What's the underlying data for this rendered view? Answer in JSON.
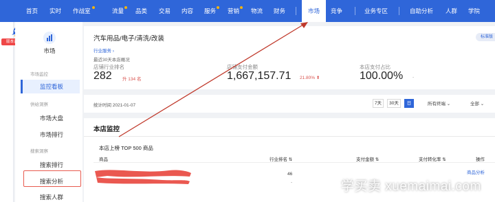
{
  "nav": {
    "items": [
      "首页",
      "实时",
      "作战室",
      "流量",
      "品类",
      "交易",
      "内容",
      "服务",
      "营销",
      "物流",
      "财务",
      "市场",
      "竞争",
      "业务专区",
      "自助分析",
      "人群",
      "学院"
    ],
    "active": "市场"
  },
  "rail": {
    "version_label": "版本说明"
  },
  "sidebar": {
    "module_label": "市场",
    "groups": [
      "市场监控",
      "供给洞察",
      "搜索洞察"
    ],
    "items": [
      "监控看板",
      "市场大盘",
      "市场排行",
      "搜索排行",
      "搜索分析",
      "搜索人群"
    ],
    "active_item": "监控看板",
    "highlighted_item": "搜索分析"
  },
  "overview": {
    "breadcrumb": "汽车用品/电子/清洗/改装",
    "industry_link": "行业服务 ›",
    "standard_badge": "标准版",
    "range_caption": "最近30天本店概况",
    "rank_label": "店铺行业排名",
    "rank_value": "282",
    "rank_change": "升 134 名",
    "pay_label": "店铺支付金额",
    "pay_value": "1,667,157.71",
    "pay_change": "21.80% ⬆",
    "share_label": "本店支付占比",
    "share_value": "100.00%",
    "share_change": "-"
  },
  "filter_bar": {
    "stat_time": "统计时间 2021-01-07",
    "ranges": [
      "7天",
      "30天",
      "日"
    ],
    "active_range": "日",
    "terminal_select": "所有终端 ⌄",
    "scope_select": "全部 ⌄"
  },
  "monitor": {
    "title": "本店监控",
    "list_title": "本店上榜 TOP 500 商品",
    "columns": [
      "商品",
      "行业排名 ⇅",
      "支付金额 ⇅",
      "支付转化率 ⇅",
      "操作"
    ],
    "rows": [
      {
        "rank": "46",
        "rank_change": "-",
        "action": "商品分析"
      }
    ]
  },
  "watermark": "学买卖 xuemaimai.com",
  "colors": {
    "brand": "#2f66d9",
    "alert": "#e85a4f",
    "up": "#d9534f"
  }
}
